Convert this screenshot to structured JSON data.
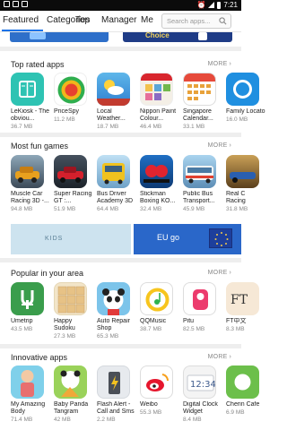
{
  "status_bar": {
    "time": "7:21"
  },
  "nav": {
    "tabs": [
      "Featured",
      "Categories",
      "Top",
      "Manager",
      "Me"
    ],
    "search_placeholder": "Search apps..."
  },
  "top_banner": {
    "right_text": "Choice"
  },
  "sections": [
    {
      "title": "Top rated apps",
      "more": "MORE",
      "apps": [
        {
          "name": "LeKiosk - The obviou...",
          "size": "36.7 MB"
        },
        {
          "name": "PriceSpy",
          "size": "11.2 MB"
        },
        {
          "name": "Local Weather...",
          "size": "18.7 MB"
        },
        {
          "name": "Nippon Paint Colour...",
          "size": "46.4 MB"
        },
        {
          "name": "Singapore Calendar...",
          "size": "33.1 MB"
        },
        {
          "name": "Family Locato",
          "size": "16.0 MB"
        }
      ]
    },
    {
      "title": "Most fun games",
      "more": "MORE",
      "apps": [
        {
          "name": "Muscle Car Racing 3D -...",
          "size": "94.8 MB"
        },
        {
          "name": "Super Racing GT :...",
          "size": "51.9 MB"
        },
        {
          "name": "Bus Driver Academy 3D",
          "size": "64.4 MB"
        },
        {
          "name": "Stickman Boxing KO...",
          "size": "32.4 MB"
        },
        {
          "name": "Public Bus Transport...",
          "size": "45.9 MB"
        },
        {
          "name": "Real C Racing",
          "size": "31.8 MB"
        }
      ]
    },
    {
      "title": "Popular in your area",
      "more": "MORE",
      "apps": [
        {
          "name": "Umetrip",
          "size": "43.5 MB"
        },
        {
          "name": "Happy Sudoku",
          "size": "27.3 MB"
        },
        {
          "name": "Auto Repair Shop",
          "size": "65.3 MB"
        },
        {
          "name": "QQMusic",
          "size": "38.7 MB"
        },
        {
          "name": "Pitu",
          "size": "82.5 MB"
        },
        {
          "name": "FT中文",
          "size": "8.3 MB"
        }
      ]
    },
    {
      "title": "Innovative apps",
      "more": "MORE",
      "apps": [
        {
          "name": "My Amazing Body",
          "size": "71.4 MB"
        },
        {
          "name": "Baby Panda Tangram",
          "size": "42 MB"
        },
        {
          "name": "Flash Alert - Call and Sms",
          "size": "2.2 MB"
        },
        {
          "name": "Weibo",
          "size": "55.3 MB"
        },
        {
          "name": "Digital Clock Widget",
          "size": "8.4 MB"
        },
        {
          "name": "Cherin Cafe",
          "size": "6.9 MB"
        }
      ]
    }
  ],
  "wide_banner": {
    "left_text": "KIDS",
    "right_text": "EU go"
  },
  "icon_names": {
    "top_rated": [
      "book-icon",
      "pricespy-icon",
      "weather-icon",
      "paint-icon",
      "calendar-icon",
      "location-icon"
    ],
    "fun_games": [
      "muscle-car-icon",
      "racing-car-icon",
      "bus-icon",
      "boxing-icon",
      "public-bus-icon",
      "race-car-icon"
    ],
    "popular": [
      "umetrip-icon",
      "sudoku-icon",
      "panda-mechanic-icon",
      "qqmusic-icon",
      "pitu-icon",
      "ft-icon"
    ],
    "innovative": [
      "anatomy-icon",
      "panda-tangram-icon",
      "flash-phone-icon",
      "weibo-icon",
      "clock-icon",
      "cafe-icon"
    ]
  }
}
